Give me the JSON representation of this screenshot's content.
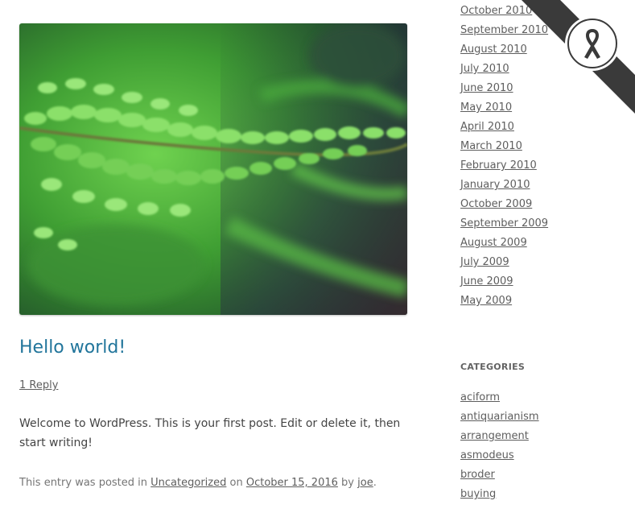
{
  "post": {
    "title": "Hello world!",
    "reply_link": "1 Reply",
    "content": "Welcome to WordPress. This is your first post. Edit or delete it, then start writing!",
    "meta": {
      "prefix": "This entry was posted in",
      "category": "Uncategorized",
      "on": "on",
      "date": "October 15, 2016",
      "by": "by",
      "author": "joe",
      "end": "."
    }
  },
  "sidebar": {
    "archives": [
      "October 2010",
      "September 2010",
      "August 2010",
      "July 2010",
      "June 2010",
      "May 2010",
      "April 2010",
      "March 2010",
      "February 2010",
      "January 2010",
      "October 2009",
      "September 2009",
      "August 2009",
      "July 2009",
      "June 2009",
      "May 2009"
    ],
    "categories_title": "CATEGORIES",
    "categories": [
      "aciform",
      "antiquarianism",
      "arrangement",
      "asmodeus",
      "broder",
      "buying"
    ]
  },
  "colors": {
    "link": "#21759b",
    "ribbon": "#3a3a3a",
    "fern": "#4fc43a"
  },
  "icons": {
    "badge": "awareness-ribbon-icon",
    "image": "fern-photo"
  }
}
